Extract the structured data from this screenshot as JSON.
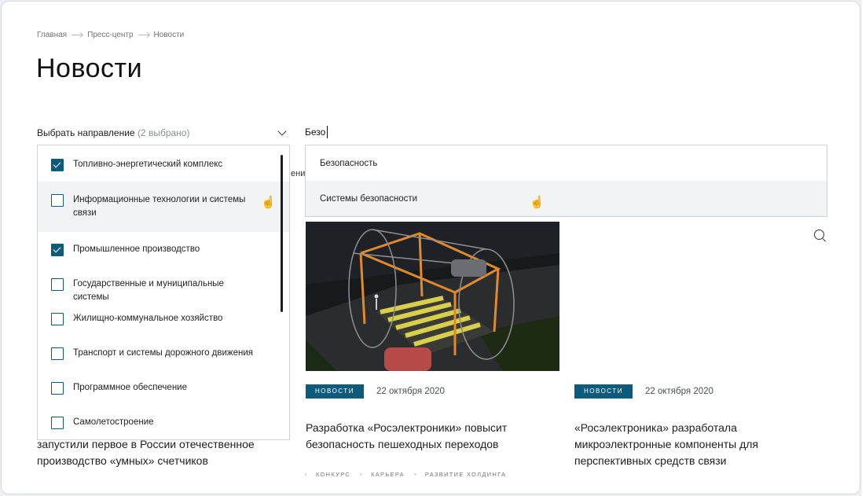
{
  "breadcrumb": [
    "Главная",
    "Пресс-центр",
    "Новости"
  ],
  "page_title": "Новости",
  "direction_filter": {
    "label": "Выбрать направление",
    "count": "(2 выбрано)",
    "items": [
      {
        "label": "Топливно-энергетический комплекс",
        "checked": true
      },
      {
        "label": "Информационные технологии и системы связи",
        "checked": false
      },
      {
        "label": "Промышленное производство",
        "checked": true
      },
      {
        "label": "Государственные и муниципальные системы",
        "checked": false
      },
      {
        "label": "Жилищно-коммунальное хозяйство",
        "checked": false
      },
      {
        "label": "Транспорт и системы дорожного движения",
        "checked": false
      },
      {
        "label": "Программное обеспечение",
        "checked": false
      },
      {
        "label": "Самолетостроение",
        "checked": false
      }
    ]
  },
  "search": {
    "value": "Безо",
    "suggestions": [
      "Безопасность",
      "Системы безопасности"
    ]
  },
  "hidden_fragment": "ени",
  "articles": [
    {
      "headline": "запустили первое в России отечественное производство «умных» счетчиков"
    },
    {
      "badge": "новости",
      "date": "22 октября 2020",
      "headline": "Разработка «Росэлектроники» повысит безопасность пешеходных переходов"
    },
    {
      "badge": "новости",
      "date": "22 октября 2020",
      "headline": "«Росэлектроника» разработала микроэлектронные компоненты для перспективных средств связи"
    }
  ],
  "tags": [
    "конкурс",
    "карьера",
    "развитие холдинга"
  ],
  "colors": {
    "accent": "#0e5a7a"
  }
}
